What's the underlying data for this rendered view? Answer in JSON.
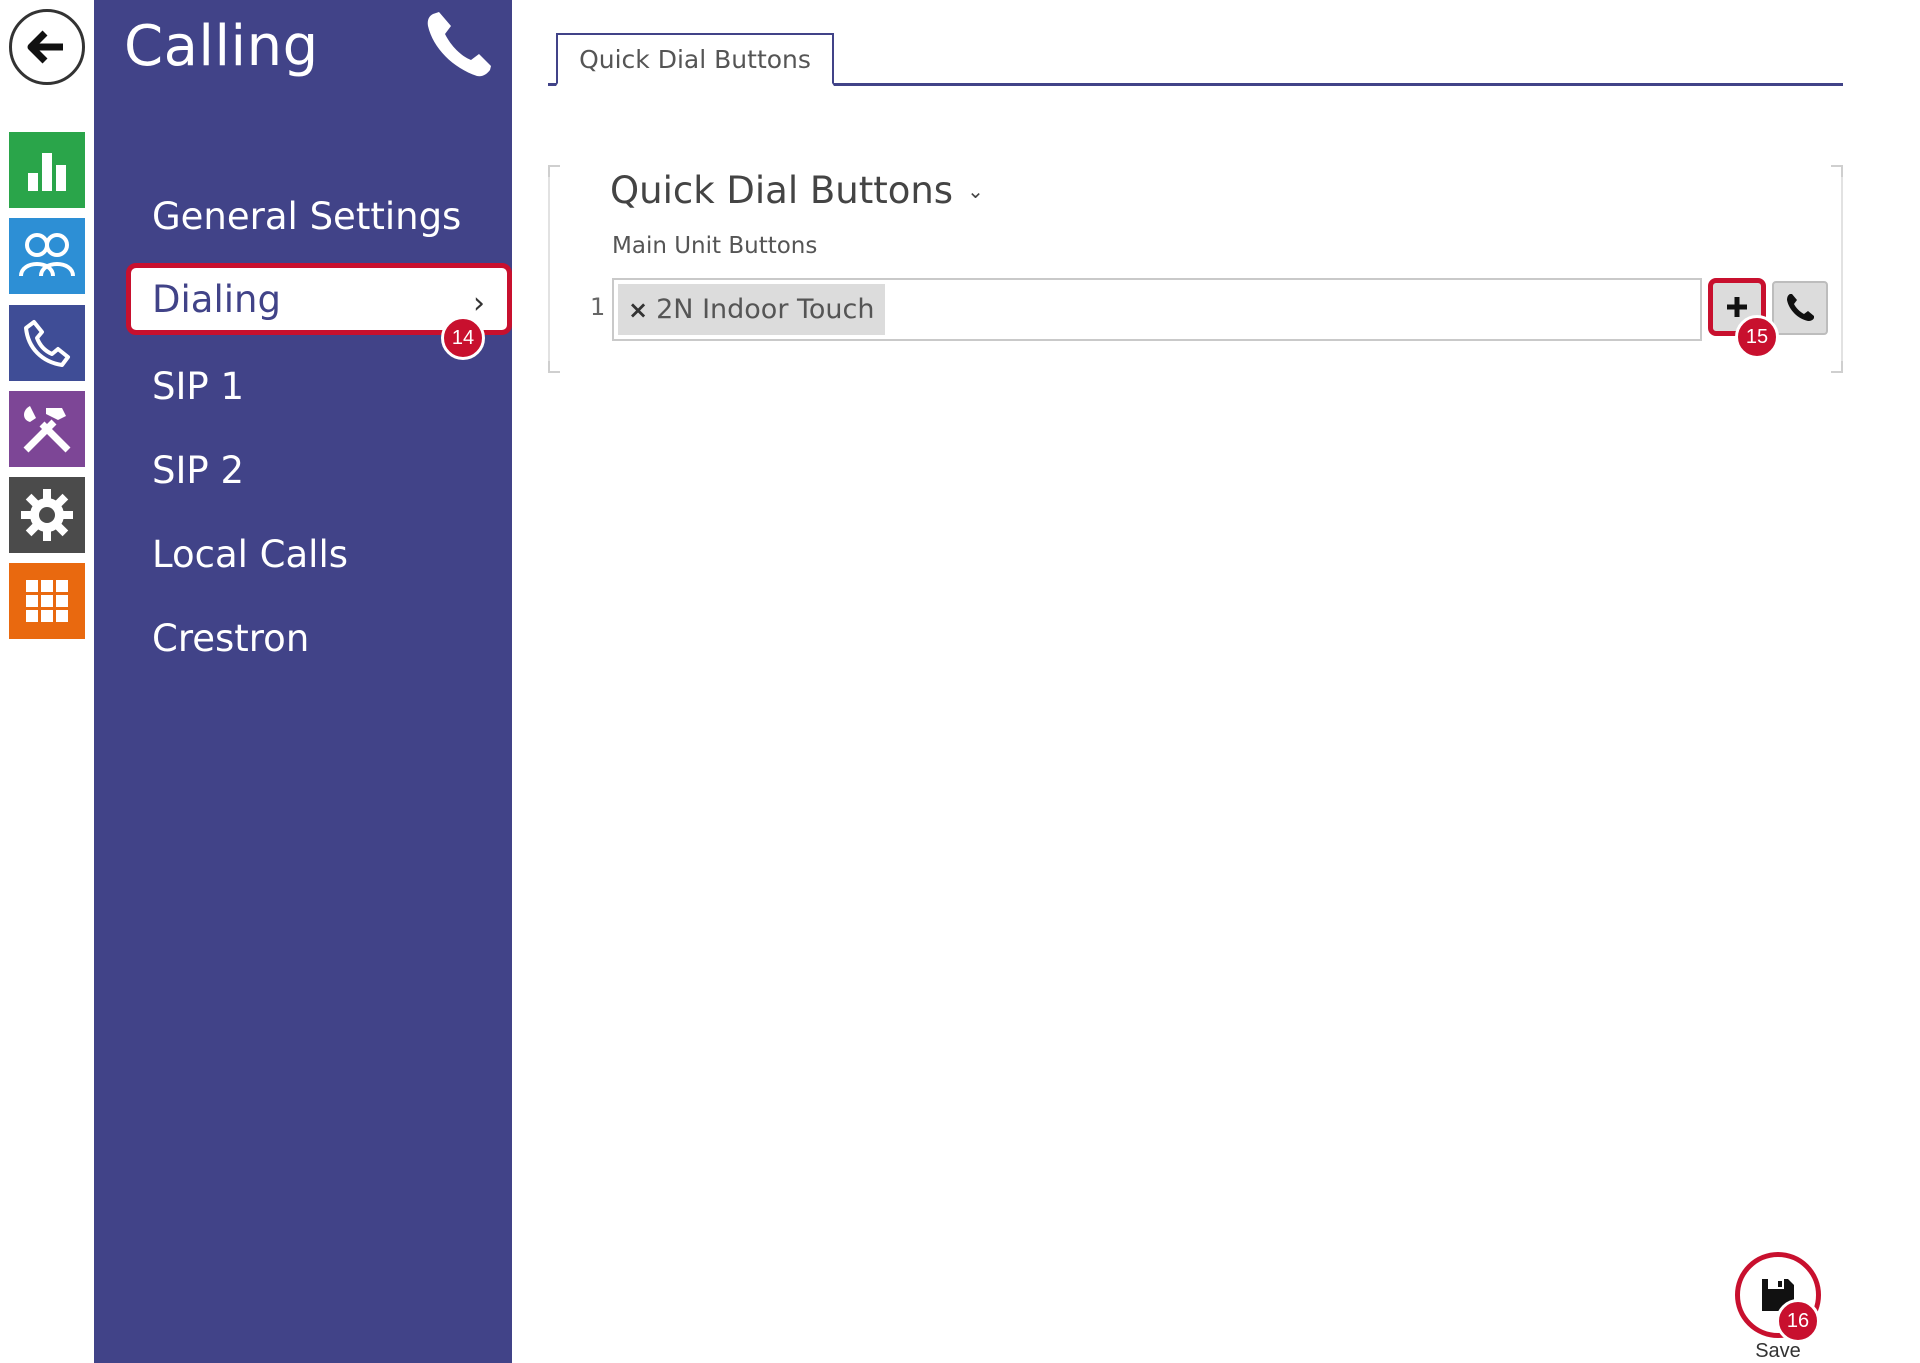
{
  "rail": {
    "items": [
      {
        "icon": "back-arrow-icon"
      },
      {
        "icon": "bar-chart-icon",
        "color": "#2aa54a"
      },
      {
        "icon": "users-icon",
        "color": "#2d8fd5"
      },
      {
        "icon": "phone-icon",
        "color": "#3f4d96"
      },
      {
        "icon": "tools-icon",
        "color": "#7d4696"
      },
      {
        "icon": "gear-icon",
        "color": "#4b4b4b"
      },
      {
        "icon": "grid-icon",
        "color": "#e9690f"
      }
    ]
  },
  "menu": {
    "title": "Calling",
    "items": [
      {
        "label": "General Settings"
      },
      {
        "label": "Dialing",
        "active": true
      },
      {
        "label": "SIP 1"
      },
      {
        "label": "SIP 2"
      },
      {
        "label": "Local Calls"
      },
      {
        "label": "Crestron"
      }
    ]
  },
  "tabs": [
    {
      "label": "Quick Dial Buttons",
      "active": true
    }
  ],
  "section": {
    "title": "Quick Dial Buttons",
    "field_label": "Main Unit Buttons",
    "row_index": "1",
    "chip_remove": "×",
    "chip_label": "2N Indoor Touch"
  },
  "actions": {
    "save_label": "Save"
  },
  "callouts": {
    "dialing": "14",
    "add": "15",
    "save": "16"
  },
  "colors": {
    "menu_bg": "#414388",
    "highlight": "#c8102e"
  }
}
